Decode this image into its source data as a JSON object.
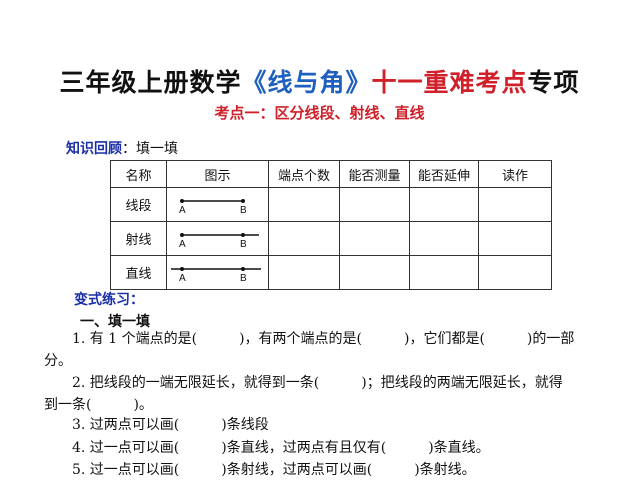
{
  "title": {
    "prefix": "三年级上册数学",
    "book": "《线与角》",
    "mid": "十一",
    "red": "重难考点",
    "suffix": "专项"
  },
  "subtitle": "考点一：区分线段、射线、直线",
  "recall": {
    "label": "知识回顾",
    "colon": "：",
    "text": "填一填"
  },
  "table": {
    "headers": [
      "名称",
      "图示",
      "端点个数",
      "能否测量",
      "能否延伸",
      "读作"
    ],
    "rows": [
      {
        "name": "线段",
        "point_a": "A",
        "point_b": "B"
      },
      {
        "name": "射线",
        "point_a": "A",
        "point_b": "B"
      },
      {
        "name": "直线",
        "point_a": "A",
        "point_b": "B"
      }
    ]
  },
  "practice_label": "变式练习：",
  "section_title": "一、填一填",
  "questions": [
    "1. 有 1 个端点的是(　　　)，有两个端点的是(　　　)，它们都是(　　　)的一部",
    "分。",
    "2. 把线段的一端无限延长，就得到一条(　　　)；把线段的两端无限延长，就得",
    "到一条(　　　)。",
    "3. 过两点可以画(　　　)条线段",
    "4. 过一点可以画(　　　)条直线，过两点有且仅有(　　　)条直线。",
    "5. 过一点可以画(　　　)条射线，过两点可以画(　　　)条射线。"
  ]
}
